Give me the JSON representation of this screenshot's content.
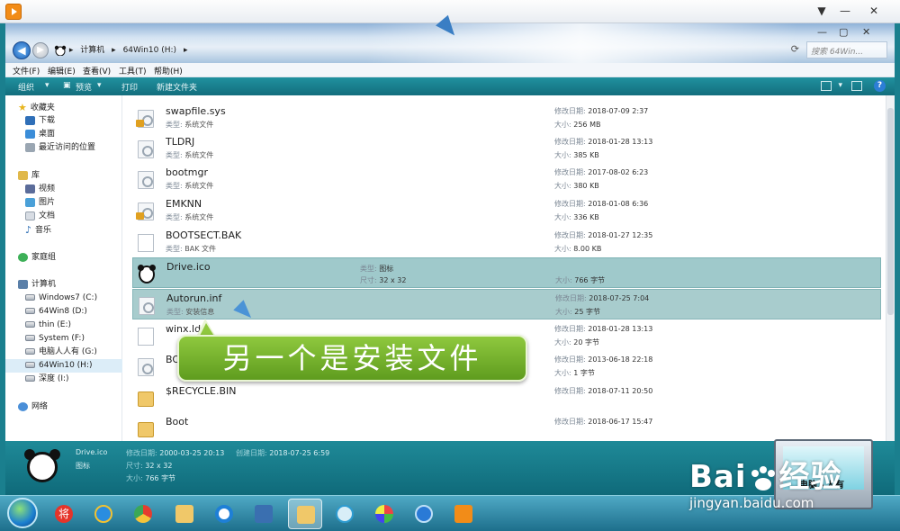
{
  "address": {
    "crumbs": [
      "计算机",
      "64Win10 (H:)"
    ],
    "search_placeholder": "搜索 64Win..."
  },
  "menubar": [
    "文件(F)",
    "编辑(E)",
    "查看(V)",
    "工具(T)",
    "帮助(H)"
  ],
  "commands": [
    "组织",
    "预览",
    "打印",
    "新建文件夹"
  ],
  "nav": {
    "favorites": "收藏夹",
    "fav_items": [
      "下载",
      "桌面",
      "最近访问的位置"
    ],
    "library": "库",
    "lib_items": [
      "视频",
      "图片",
      "文档",
      "音乐"
    ],
    "homegroup": "家庭组",
    "computer": "计算机",
    "drives": [
      "Windows7 (C:)",
      "64Win8 (D:)",
      "thin (E:)",
      "System (F:)",
      "电脑人人有 (G:)",
      "64Win10 (H:)",
      "深度 (I:)"
    ],
    "network": "网络"
  },
  "labels": {
    "type": "类型:",
    "modified": "修改日期:",
    "size": "大小:",
    "dimensions": "尺寸:",
    "created": "创建日期:"
  },
  "files": [
    {
      "name": "swapfile.sys",
      "type": "系统文件",
      "date": "2018-07-09 2:37",
      "size": "256 MB"
    },
    {
      "name": "TLDRJ",
      "type": "系统文件",
      "date": "2018-01-28 13:13",
      "size": "385 KB"
    },
    {
      "name": "bootmgr",
      "type": "系统文件",
      "date": "2017-08-02 6:23",
      "size": "380 KB"
    },
    {
      "name": "EMKNN",
      "type": "系统文件",
      "date": "2018-01-08 6:36",
      "size": "336 KB"
    },
    {
      "name": "BOOTSECT.BAK",
      "type": "BAK 文件",
      "date": "2018-01-27 12:35",
      "size": "8.00 KB"
    },
    {
      "name": "Drive.ico",
      "type": "图标",
      "dimensions": "32 x 32",
      "size": "766 字节"
    },
    {
      "name": "Autorun.inf",
      "type": "安装信息",
      "date": "2018-07-25 7:04",
      "size": "25 字节"
    },
    {
      "name": "winx.ld",
      "type": "",
      "date": "2018-01-28 13:13",
      "size": "20 字节"
    },
    {
      "name": "BOO",
      "type": "",
      "date": "2013-06-18 22:18",
      "size": "1 字节"
    },
    {
      "name": "$RECYCLE.BIN",
      "type": "",
      "date": "2018-07-11 20:50",
      "size": ""
    },
    {
      "name": "Boot",
      "type": "",
      "date": "2018-06-17 15:47",
      "size": ""
    }
  ],
  "details": {
    "name": "Drive.ico",
    "modified_label": "修改日期:",
    "modified": "2000-03-25 20:13",
    "created_label": "创建日期:",
    "created": "2018-07-25 6:59",
    "type": "图标",
    "dimensions_label": "尺寸:",
    "dimensions": "32 x 32",
    "size_label": "大小:",
    "size": "766 字节"
  },
  "caption": "另一个是安装文件",
  "watermark": {
    "logo": "Bai",
    "logo_suffix": "经验",
    "url": "jingyan.baidu.com",
    "laptop_text": "电脑人人有"
  },
  "taskbar": {
    "app_letter": "将"
  },
  "colors": {
    "selection": "#9fc9cb",
    "caption_bg": "#7cb82f",
    "window_frame": "#1a7f8e"
  }
}
